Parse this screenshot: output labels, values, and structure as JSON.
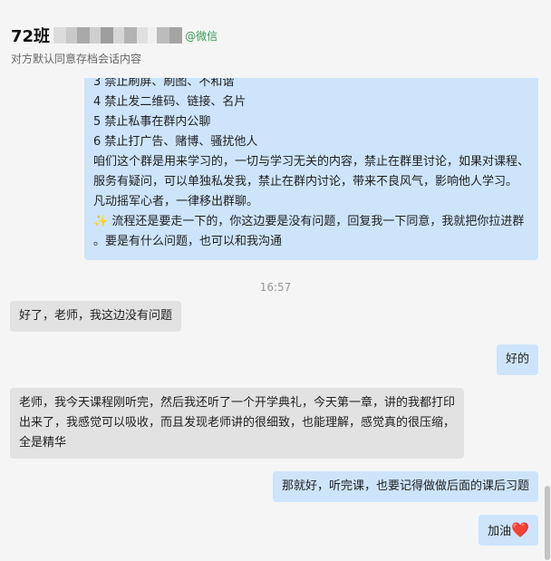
{
  "header": {
    "title": "72班",
    "wechat_tag": "@微信",
    "subtitle": "对方默认同意存档会话内容"
  },
  "messages": {
    "m1": {
      "lines": [
        "3 禁止刷屏、刷图、不和谐",
        "4 禁止发二维码、链接、名片",
        "5 禁止私事在群内公聊",
        "6 禁止打广告、赌博、骚扰他人",
        "咱们这个群是用来学习的，一切与学习无关的内容，禁止在群里讨论，如果对课程、",
        "服务有疑问，可以单独私发我，禁止在群内讨论，带来不良风气，影响他人学习。",
        "凡动摇军心者，一律移出群聊。",
        "流程还是要走一下的，你这边要是没有问题，回复我一下同意，我就把你拉进群",
        "。要是有什么问题，也可以和我沟通"
      ],
      "sparkle": "✨"
    },
    "time": "16:57",
    "m2": "好了，老师，我这边没有问题",
    "m3": "好的",
    "m4": {
      "lines": [
        "老师，我今天课程刚听完，然后我还听了一个开学典礼，今天第一章，讲的我都打印",
        "出来了，我感觉可以吸收，而且发现老师讲的很细致，也能理解，感觉真的很压缩，",
        "全是精华"
      ]
    },
    "m5": "那就好，听完课，也要记得做做后面的课后习题",
    "m6": {
      "text": "加油",
      "heart": "❤️"
    }
  }
}
